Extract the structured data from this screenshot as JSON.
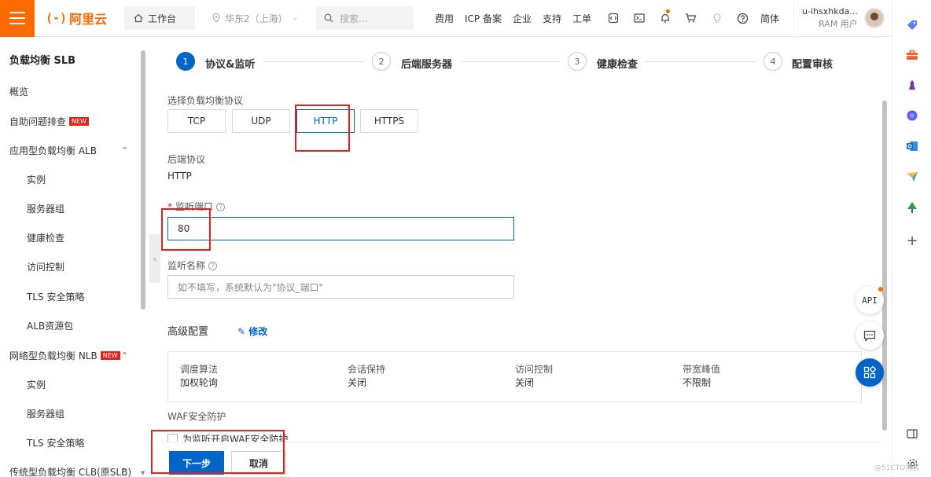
{
  "topbar": {
    "logo_mark": "(-)",
    "logo_text": "阿里云",
    "workbench": "工作台",
    "region": "华东2（上海）",
    "search_placeholder": "搜索...",
    "links": [
      "费用",
      "ICP 备案",
      "企业",
      "支持",
      "工单"
    ],
    "lang": "简体",
    "user_name": "u-ihsxhkda...",
    "user_role": "RAM 用户"
  },
  "sidebar": {
    "title": "负载均衡 SLB",
    "items": [
      {
        "label": "概览",
        "level": 1
      },
      {
        "label": "自助问题排查",
        "level": 1,
        "badge": "NEW"
      },
      {
        "label": "应用型负载均衡 ALB",
        "level": 1,
        "expanded": true
      },
      {
        "label": "实例",
        "level": 2
      },
      {
        "label": "服务器组",
        "level": 2
      },
      {
        "label": "健康检查",
        "level": 2
      },
      {
        "label": "访问控制",
        "level": 2
      },
      {
        "label": "TLS 安全策略",
        "level": 2
      },
      {
        "label": "ALB资源包",
        "level": 2
      },
      {
        "label": "网络型负载均衡 NLB",
        "level": 1,
        "badge": "NEW",
        "expanded": true
      },
      {
        "label": "实例",
        "level": 2
      },
      {
        "label": "服务器组",
        "level": 2
      },
      {
        "label": "TLS 安全策略",
        "level": 2
      },
      {
        "label": "传统型负载均衡 CLB(原SLB)",
        "level": 1,
        "expanded": true
      }
    ]
  },
  "steps": [
    {
      "num": "1",
      "label": "协议&监听",
      "active": true
    },
    {
      "num": "2",
      "label": "后端服务器",
      "active": false
    },
    {
      "num": "3",
      "label": "健康检查",
      "active": false
    },
    {
      "num": "4",
      "label": "配置审核",
      "active": false
    }
  ],
  "form": {
    "protocol_label": "选择负载均衡协议",
    "protocols": [
      "TCP",
      "UDP",
      "HTTP",
      "HTTPS"
    ],
    "selected_protocol": "HTTP",
    "backend_protocol_label": "后端协议",
    "backend_protocol_value": "HTTP",
    "port_label": "监听端口",
    "port_value": "80",
    "name_label": "监听名称",
    "name_placeholder": "如不填写，系统默认为\"协议_端口\"",
    "advanced_title": "高级配置",
    "edit_label": "修改",
    "advanced": [
      {
        "key": "调度算法",
        "value": "加权轮询"
      },
      {
        "key": "会话保持",
        "value": "关闭"
      },
      {
        "key": "访问控制",
        "value": "关闭"
      },
      {
        "key": "带宽峰值",
        "value": "不限制"
      }
    ],
    "waf_title": "WAF安全防护",
    "waf_checkbox": "为监听开启WAF安全防护"
  },
  "footer": {
    "next": "下一步",
    "cancel": "取消"
  },
  "floating": {
    "api": "API"
  },
  "watermark": "@51CTO博客",
  "colors": {
    "brand": "#ff6a00",
    "primary": "#0064c8",
    "highlight": "#e2231a"
  }
}
